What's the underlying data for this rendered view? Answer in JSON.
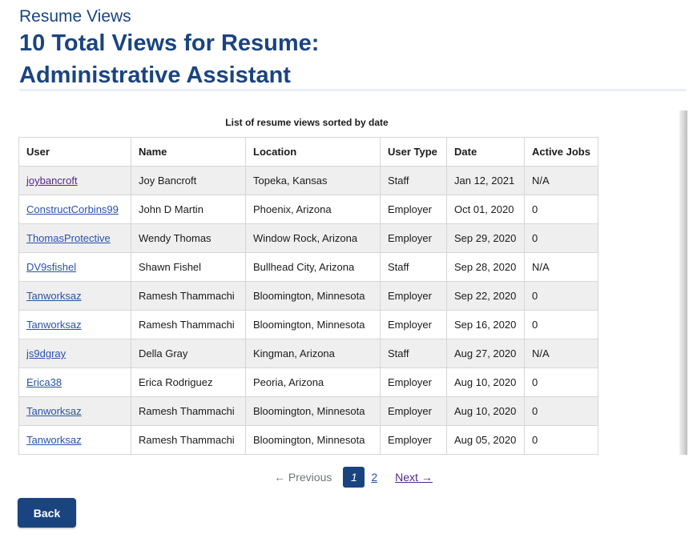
{
  "header": {
    "subtitle": "Resume Views",
    "title": "10 Total Views for Resume: Administrative Assistant"
  },
  "table": {
    "caption": "List of resume views sorted by date",
    "columns": [
      "User",
      "Name",
      "Location",
      "User Type",
      "Date",
      "Active Jobs"
    ],
    "rows": [
      {
        "user": "joybancroft",
        "name": "Joy Bancroft",
        "location": "Topeka, Kansas",
        "user_type": "Staff",
        "date": "Jan 12, 2021",
        "active_jobs": "N/A"
      },
      {
        "user": "ConstructCorbins99",
        "name": "John D Martin",
        "location": "Phoenix, Arizona",
        "user_type": "Employer",
        "date": "Oct 01, 2020",
        "active_jobs": "0"
      },
      {
        "user": "ThomasProtective",
        "name": "Wendy Thomas",
        "location": "Window Rock, Arizona",
        "user_type": "Employer",
        "date": "Sep 29, 2020",
        "active_jobs": "0"
      },
      {
        "user": "DV9sfishel",
        "name": "Shawn Fishel",
        "location": "Bullhead City, Arizona",
        "user_type": "Staff",
        "date": "Sep 28, 2020",
        "active_jobs": "N/A"
      },
      {
        "user": "Tanworksaz",
        "name": "Ramesh Thammachi",
        "location": "Bloomington, Minnesota",
        "user_type": "Employer",
        "date": "Sep 22, 2020",
        "active_jobs": "0"
      },
      {
        "user": "Tanworksaz",
        "name": "Ramesh Thammachi",
        "location": "Bloomington, Minnesota",
        "user_type": "Employer",
        "date": "Sep 16, 2020",
        "active_jobs": "0"
      },
      {
        "user": "js9dgray",
        "name": "Della Gray",
        "location": "Kingman, Arizona",
        "user_type": "Staff",
        "date": "Aug 27, 2020",
        "active_jobs": "N/A"
      },
      {
        "user": "Erica38",
        "name": "Erica Rodriguez",
        "location": "Peoria, Arizona",
        "user_type": "Employer",
        "date": "Aug 10, 2020",
        "active_jobs": "0"
      },
      {
        "user": "Tanworksaz",
        "name": "Ramesh Thammachi",
        "location": "Bloomington, Minnesota",
        "user_type": "Employer",
        "date": "Aug 10, 2020",
        "active_jobs": "0"
      },
      {
        "user": "Tanworksaz",
        "name": "Ramesh Thammachi",
        "location": "Bloomington, Minnesota",
        "user_type": "Employer",
        "date": "Aug 05, 2020",
        "active_jobs": "0"
      }
    ]
  },
  "pagination": {
    "previous": "← Previous",
    "current": "1",
    "page_2": "2",
    "next": "Next →"
  },
  "actions": {
    "back": "Back"
  },
  "colors": {
    "brand": "#1a4480",
    "link": "#2a52a8",
    "visited": "#54278f",
    "row_stripe": "#efefef"
  }
}
